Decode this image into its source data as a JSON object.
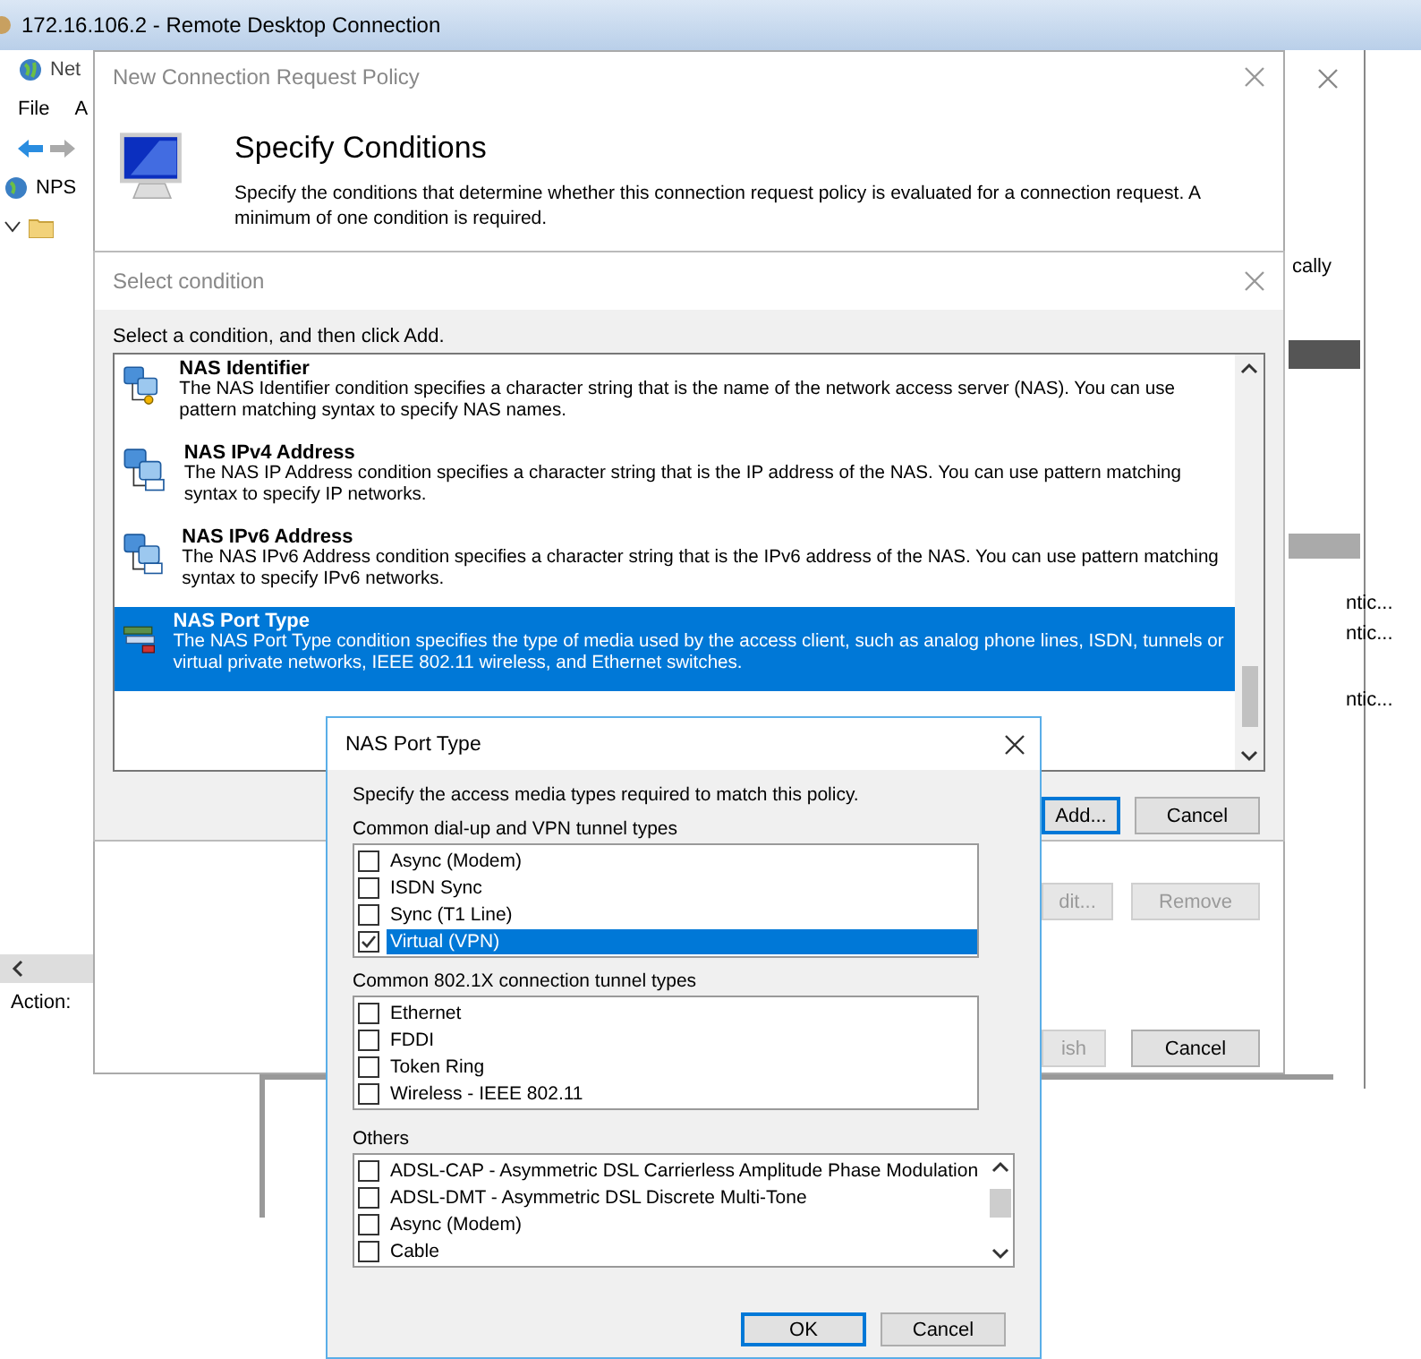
{
  "remote_desktop": {
    "title": "172.16.106.2 - Remote Desktop Connection"
  },
  "console": {
    "title": "Net",
    "menu": [
      "File",
      "A"
    ],
    "tree": [
      {
        "label": "NPS",
        "expanded": true
      }
    ],
    "status": "Action:",
    "side_texts": [
      "cally",
      "ntic...",
      "ntic...",
      "ntic..."
    ]
  },
  "wizard": {
    "title": "New Connection Request Policy",
    "heading": "Specify Conditions",
    "description": "Specify the conditions that determine whether this connection request policy is evaluated for a connection request. A minimum of one condition is required.",
    "buttons": [
      {
        "label": "dit...",
        "disabled": true
      },
      {
        "label": "Remove",
        "disabled": true
      },
      {
        "label": "ish",
        "disabled": true
      },
      {
        "label": "Cancel",
        "disabled": false
      }
    ]
  },
  "select_condition": {
    "title": "Select condition",
    "instruction": "Select a condition, and then click Add.",
    "conditions": [
      {
        "name": "NAS Identifier",
        "description": "The NAS Identifier condition specifies a character string that is the name of the network access server (NAS). You can use pattern matching syntax to specify NAS names.",
        "selected": false
      },
      {
        "name": "NAS IPv4 Address",
        "description": "The NAS IP Address condition specifies a character string that is the IP address of the NAS. You can use pattern matching syntax to specify IP networks.",
        "selected": false
      },
      {
        "name": "NAS IPv6 Address",
        "description": "The NAS IPv6 Address condition specifies a character string that is the IPv6 address of the NAS. You can use pattern matching syntax to specify IPv6 networks.",
        "selected": false
      },
      {
        "name": "NAS Port Type",
        "description": "The NAS Port Type condition specifies the type of media used by the access client, such as analog phone lines, ISDN, tunnels or virtual private networks, IEEE 802.11 wireless, and Ethernet switches.",
        "selected": true
      }
    ],
    "buttons": [
      {
        "label": "Add...",
        "default": true
      },
      {
        "label": "Cancel",
        "default": false
      }
    ]
  },
  "nas_port_type": {
    "title": "NAS Port Type",
    "instruction": "Specify the access media types required to match this policy.",
    "groups": [
      {
        "label": "Common dial-up and VPN tunnel types",
        "items": [
          {
            "label": "Async (Modem)",
            "checked": false,
            "selected": false
          },
          {
            "label": "ISDN Sync",
            "checked": false,
            "selected": false
          },
          {
            "label": "Sync (T1 Line)",
            "checked": false,
            "selected": false
          },
          {
            "label": "Virtual (VPN)",
            "checked": true,
            "selected": true
          }
        ]
      },
      {
        "label": "Common 802.1X connection tunnel types",
        "items": [
          {
            "label": "Ethernet",
            "checked": false,
            "selected": false
          },
          {
            "label": "FDDI",
            "checked": false,
            "selected": false
          },
          {
            "label": "Token Ring",
            "checked": false,
            "selected": false
          },
          {
            "label": "Wireless - IEEE 802.11",
            "checked": false,
            "selected": false
          }
        ]
      },
      {
        "label": "Others",
        "items": [
          {
            "label": "ADSL-CAP - Asymmetric DSL Carrierless Amplitude Phase Modulation",
            "checked": false,
            "selected": false
          },
          {
            "label": "ADSL-DMT - Asymmetric DSL Discrete Multi-Tone",
            "checked": false,
            "selected": false
          },
          {
            "label": "Async (Modem)",
            "checked": false,
            "selected": false
          },
          {
            "label": "Cable",
            "checked": false,
            "selected": false
          }
        ]
      }
    ],
    "buttons": [
      {
        "label": "OK",
        "default": true
      },
      {
        "label": "Cancel",
        "default": false
      }
    ]
  }
}
